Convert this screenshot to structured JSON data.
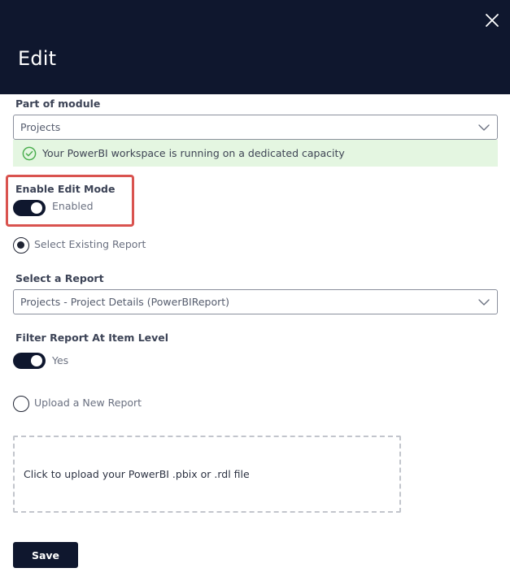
{
  "header": {
    "title": "Edit",
    "close_icon": "close-icon",
    "background": "#0f172e"
  },
  "module": {
    "label": "Part of module",
    "value": "Projects"
  },
  "notice": {
    "text": "Your PowerBI workspace is running on a dedicated capacity",
    "icon": "check-circle-icon",
    "color": "#4caf50"
  },
  "edit_mode": {
    "label": "Enable Edit Mode",
    "state_text": "Enabled",
    "on": true,
    "highlight_color": "#d9534f"
  },
  "report_source": {
    "existing_label": "Select Existing Report",
    "existing_checked": true,
    "upload_label": "Upload a New Report",
    "upload_checked": false
  },
  "report_select": {
    "label": "Select a Report",
    "value": "Projects - Project Details (PowerBIReport)"
  },
  "filter_item_level": {
    "label": "Filter Report At Item Level",
    "state_text": "Yes",
    "on": true
  },
  "upload": {
    "dropzone_text": "Click to upload your PowerBI .pbix or .rdl file"
  },
  "actions": {
    "save_label": "Save"
  }
}
